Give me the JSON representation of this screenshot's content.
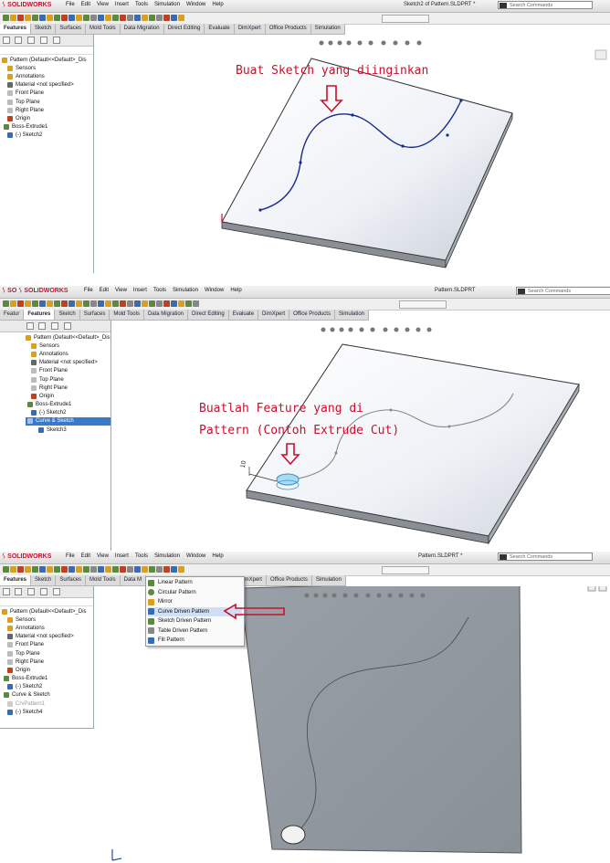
{
  "app": {
    "logo_text": "SOLIDWORKS",
    "menu": [
      "File",
      "Edit",
      "View",
      "Insert",
      "Tools",
      "Simulation",
      "Window",
      "Help"
    ],
    "search_placeholder": "Search Commands",
    "tabs": [
      "Features",
      "Sketch",
      "Surfaces",
      "Mold Tools",
      "Data Migration",
      "Direct Editing",
      "Evaluate",
      "DimXpert",
      "Office Products",
      "Simulation"
    ]
  },
  "panel1": {
    "title": "Sketch2 of Pattern.SLDPRT *",
    "tree": [
      "Pattern  (Default<<Default>_Dis",
      "Sensors",
      "Annotations",
      "Material <not specified>",
      "Front Plane",
      "Top Plane",
      "Right Plane",
      "Origin",
      "Boss-Extrude1",
      "(-) Sketch2"
    ],
    "annotation": "Buat Sketch yang diinginkan"
  },
  "panel2": {
    "title": "Pattern.SLDPRT",
    "tabs_left": "Featur",
    "tree": [
      "Pattern  (Default<<Default>_Dis",
      "Sensors",
      "Annotations",
      "Material <not specified>",
      "Front Plane",
      "Top Plane",
      "Right Plane",
      "Origin",
      "Boss-Extrude1",
      "(-) Sketch2",
      "Curve & Sketch",
      "Sketch3"
    ],
    "annotation_line1": "Buatlah Feature yang di",
    "annotation_line2": "Pattern (Contoh Extrude Cut)",
    "dimension": "10"
  },
  "panel3": {
    "title": "Pattern.SLDPRT *",
    "tree": [
      "Pattern  (Default<<Default>_Dis",
      "Sensors",
      "Annotations",
      "Material <not specified>",
      "Front Plane",
      "Top Plane",
      "Right Plane",
      "Origin",
      "Boss-Extrude1",
      "(-) Sketch2",
      "Curve & Sketch",
      "CrvPattern1",
      "(-) Sketch4"
    ],
    "dropdown": [
      "Linear Pattern",
      "Circular Pattern",
      "Mirror",
      "Curve Driven Pattern",
      "Sketch Driven Pattern",
      "Table Driven Pattern",
      "Fill Pattern"
    ],
    "selected_item": "Curve Driven Pattern",
    "tabs_cut": "Data M"
  },
  "colors": {
    "annotation": "#c8102e",
    "highlight": "#3a78c8",
    "plate": "#e8ecf2"
  }
}
